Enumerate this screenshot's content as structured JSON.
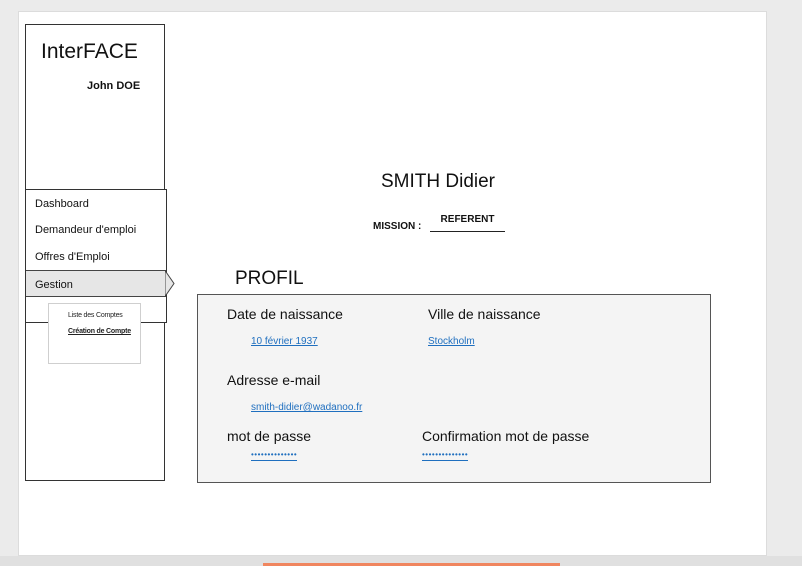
{
  "app": {
    "title": "InterFACE",
    "user": "John DOE"
  },
  "menu": {
    "items": [
      {
        "label": "Dashboard"
      },
      {
        "label": "Demandeur d'emploi"
      },
      {
        "label": "Offres d'Emploi"
      },
      {
        "label": "Gestion"
      }
    ],
    "active": "Gestion",
    "submenu": [
      {
        "label": "Liste des Comptes"
      },
      {
        "label": "Création de Compte"
      }
    ]
  },
  "person": {
    "name": "SMITH Didier"
  },
  "mission": {
    "label": "MISSION :",
    "value": "REFERENT"
  },
  "profile": {
    "title": "PROFIL",
    "birth_date": {
      "label": "Date de naissance",
      "value": "10 février 1937"
    },
    "birth_city": {
      "label": "Ville de naissance",
      "value": "Stockholm"
    },
    "email": {
      "label": "Adresse  e-mail",
      "value": "smith-didier@wadanoo.fr"
    },
    "password": {
      "label": "mot de passe",
      "value": "••••••••••••••"
    },
    "password_confirm": {
      "label": "Confirmation mot de passe",
      "value": "••••••••••••••"
    }
  },
  "colors": {
    "link": "#1f6fbf",
    "panel_bg": "#f4f4f4",
    "accent_bar": "#f0865f"
  }
}
